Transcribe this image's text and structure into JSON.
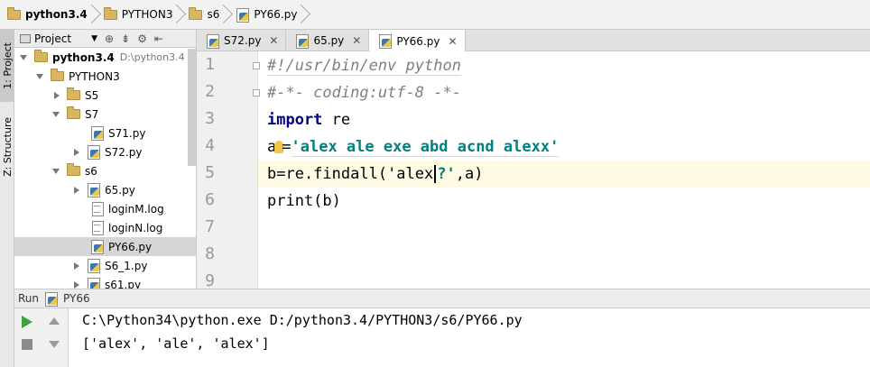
{
  "breadcrumb": [
    {
      "label": "python3.4",
      "icon": "folder-icon",
      "bold": true
    },
    {
      "label": "PYTHON3",
      "icon": "folder-icon",
      "bold": false
    },
    {
      "label": "s6",
      "icon": "folder-icon",
      "bold": false
    },
    {
      "label": "PY66.py",
      "icon": "python-file-icon",
      "bold": false
    }
  ],
  "left_strip": {
    "project_tab": "1: Project",
    "structure_tab": "Z: Structure"
  },
  "project_panel": {
    "title": "Project",
    "tree": [
      {
        "label": "python3.4",
        "path": "D:\\python3.4",
        "type": "folder",
        "expanded": true,
        "depth": 0,
        "bold": true
      },
      {
        "label": "PYTHON3",
        "type": "folder",
        "expanded": true,
        "depth": 1
      },
      {
        "label": "S5",
        "type": "folder",
        "expanded": false,
        "depth": 2
      },
      {
        "label": "S7",
        "type": "folder",
        "expanded": true,
        "depth": 2
      },
      {
        "label": "S71.py",
        "type": "py",
        "depth": 3
      },
      {
        "label": "S72.py",
        "type": "py",
        "expandable": true,
        "depth": 3
      },
      {
        "label": "s6",
        "type": "folder",
        "expanded": true,
        "depth": 2
      },
      {
        "label": "65.py",
        "type": "py",
        "expandable": true,
        "depth": 3
      },
      {
        "label": "loginM.log",
        "type": "log",
        "depth": 3
      },
      {
        "label": "loginN.log",
        "type": "log",
        "depth": 3
      },
      {
        "label": "PY66.py",
        "type": "py",
        "depth": 3,
        "selected": true
      },
      {
        "label": "S6_1.py",
        "type": "py",
        "expandable": true,
        "depth": 3
      },
      {
        "label": "s61.py",
        "type": "py",
        "expandable": true,
        "depth": 3
      }
    ]
  },
  "editor_tabs": [
    {
      "label": "S72.py",
      "active": false
    },
    {
      "label": "65.py",
      "active": false
    },
    {
      "label": "PY66.py",
      "active": true
    }
  ],
  "editor": {
    "line_numbers": [
      "1",
      "2",
      "3",
      "4",
      "5",
      "6",
      "7",
      "8",
      "9"
    ],
    "lines": {
      "l1": "#!/usr/bin/env python",
      "l2": "#-*- coding:utf-8 -*-",
      "l3_kw": "import",
      "l3_rest": " re",
      "l4_a": "a",
      "l4_eq": "=",
      "l4_str": "'alex ale exe abd acnd alexx'",
      "l5_pre": "b=re.findall(",
      "l5_str1": "'alex",
      "l5_str2": "?'",
      "l5_post": ",a)",
      "l6": "print(b)"
    }
  },
  "run": {
    "title": "Run",
    "config": "PY66",
    "console": [
      "C:\\Python34\\python.exe D:/python3.4/PYTHON3/s6/PY66.py",
      "['alex', 'ale', 'alex']"
    ]
  }
}
